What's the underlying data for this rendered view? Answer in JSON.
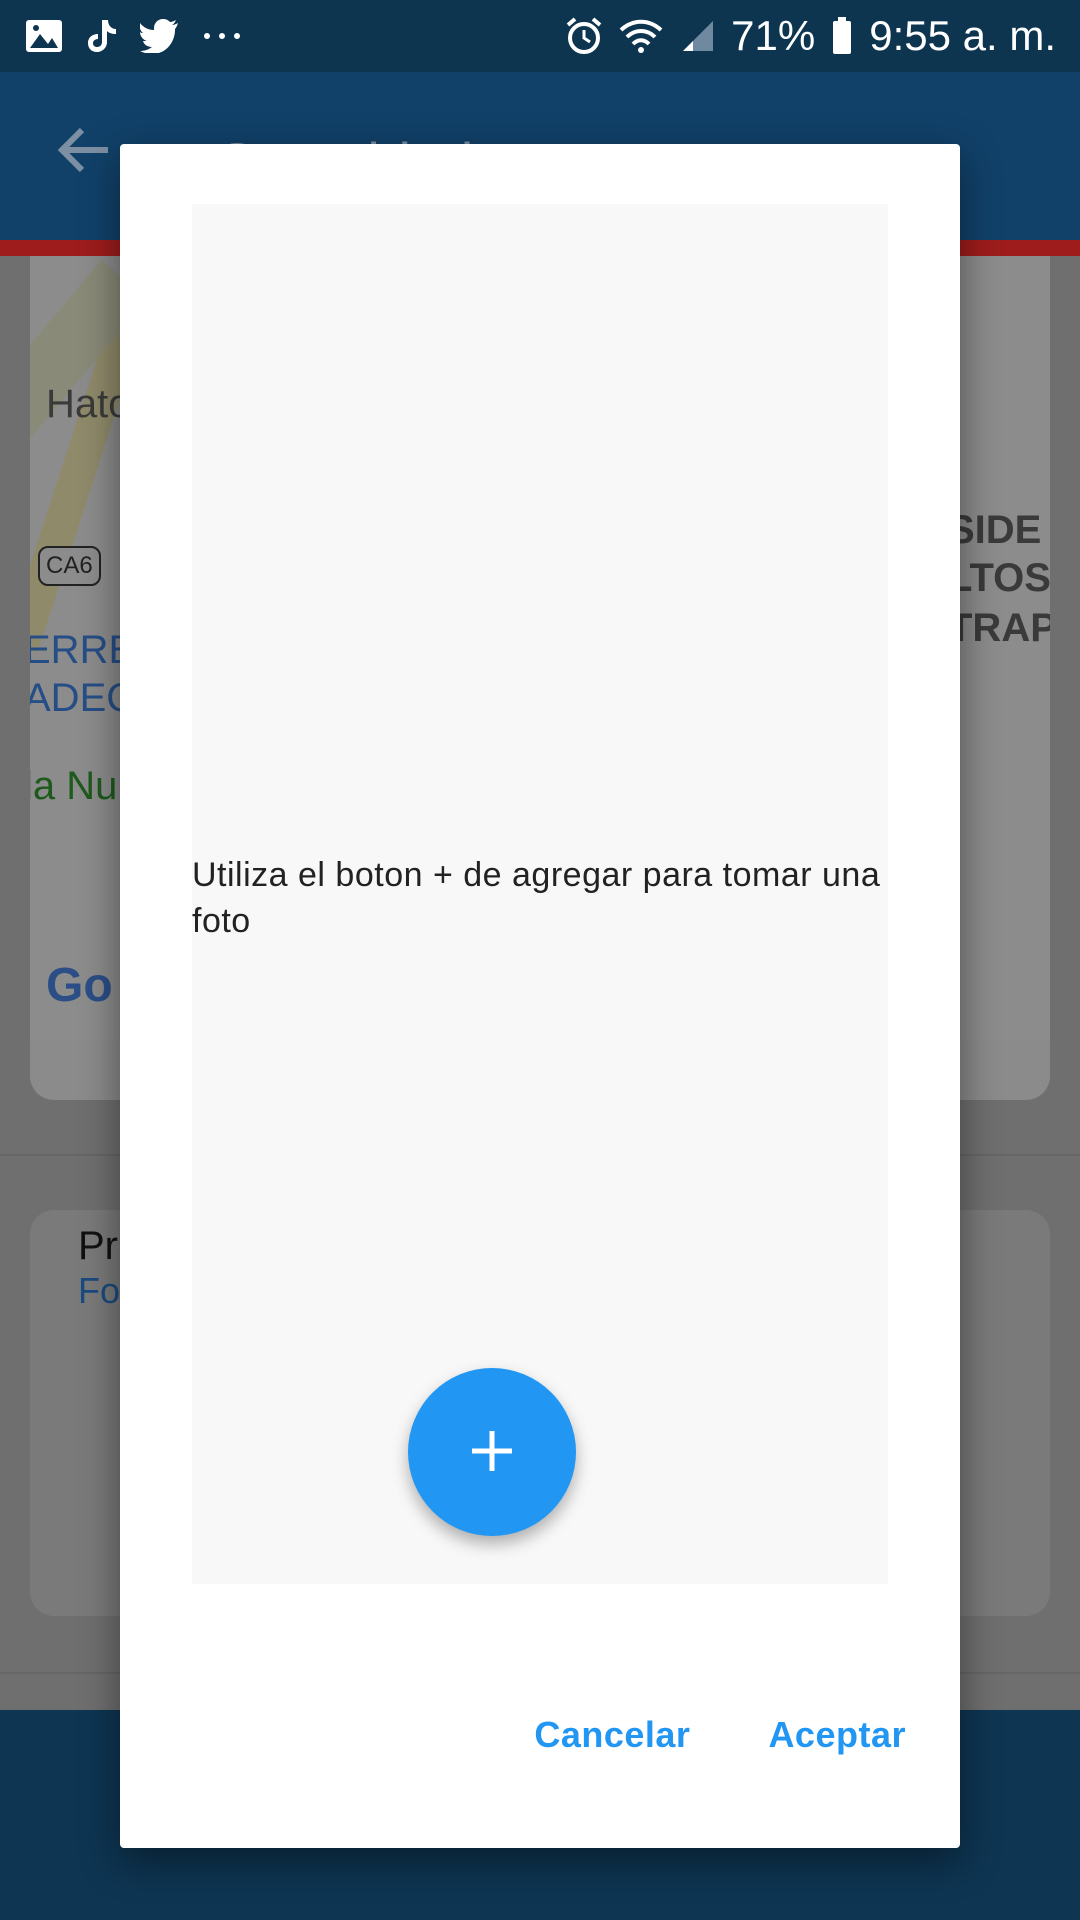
{
  "status_bar": {
    "battery": "71%",
    "time": "9:55 a. m.",
    "icons": [
      "gallery-icon",
      "tiktok-icon",
      "twitter-icon",
      "more-icon",
      "alarm-icon",
      "wifi-icon",
      "signal-icon",
      "battery-icon"
    ]
  },
  "background": {
    "app_title": "Seguridad",
    "map_labels": {
      "hato": "Hato",
      "route": "CA6",
      "left_blue_1": "ERRE",
      "left_blue_2": "ADEC",
      "green": "la Nu",
      "right_1": "SIDE",
      "right_2": "LTOS",
      "right_3": "TRAP",
      "google": "Go"
    },
    "card_title": "Pr",
    "card_subtitle": "Fo"
  },
  "dialog": {
    "hint": "Utiliza el boton + de agregar para tomar una foto",
    "fab_icon": "plus-icon",
    "cancel_label": "Cancelar",
    "accept_label": "Aceptar"
  },
  "colors": {
    "accent": "#2196f3",
    "app_bar": "#114169",
    "status_bar": "#0e3550"
  }
}
